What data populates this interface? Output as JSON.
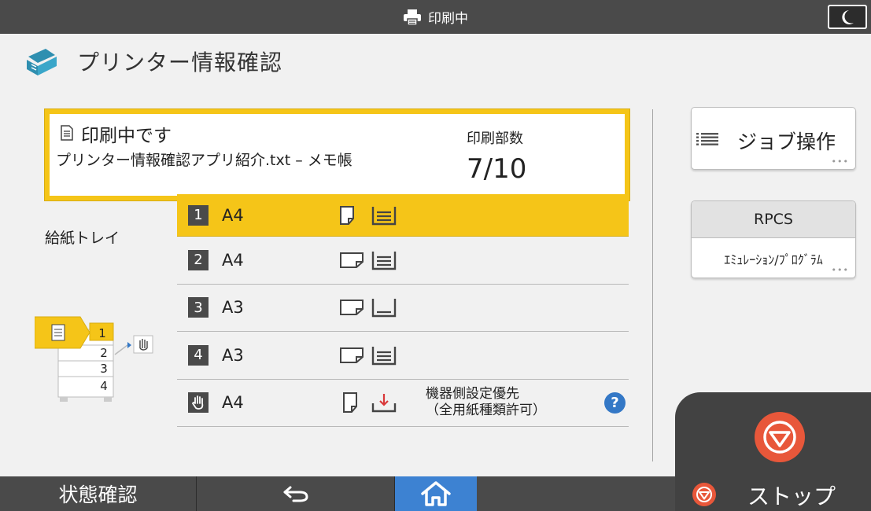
{
  "topbar": {
    "status": "印刷中",
    "status_icon": "printer-icon",
    "night_icon": "moon-icon"
  },
  "header": {
    "title": "プリンター情報確認",
    "icon": "printer-app-icon"
  },
  "job": {
    "status": "印刷中です",
    "file": "プリンター情報確認アプリ紹介.txt – メモ帳",
    "copies_label": "印刷部数",
    "copies": "7/10"
  },
  "tray_label": "給紙トレイ",
  "trays": [
    {
      "num": "1",
      "size": "A4"
    },
    {
      "num": "2",
      "size": "A4"
    },
    {
      "num": "3",
      "size": "A3"
    },
    {
      "num": "4",
      "size": "A3"
    },
    {
      "num": "",
      "size": "A4",
      "note_1": "機器側設定優先",
      "note_2": "（全用紙種類許可）"
    }
  ],
  "tray_illus": {
    "trays": [
      "1",
      "2",
      "3",
      "4"
    ]
  },
  "job_button": "ジョブ操作",
  "rpcs": {
    "title": "RPCS",
    "sub": "ｴﾐｭﾚｰｼｮﾝ/ﾌﾟﾛｸﾞﾗﾑ"
  },
  "bottom": {
    "status_check": "状態確認",
    "stop": "ストップ"
  },
  "colors": {
    "accent": "#f5c518",
    "bar": "#4a4a4a",
    "home": "#3d82d2",
    "stop": "#e8573a"
  }
}
